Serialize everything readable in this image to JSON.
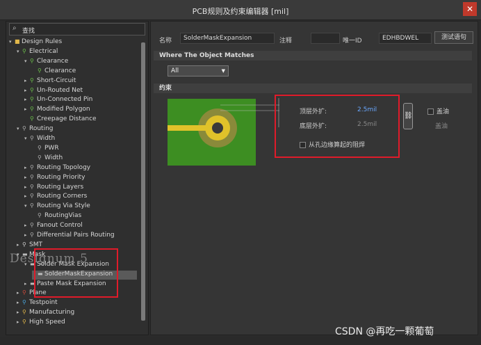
{
  "window": {
    "title": "PCB规则及约束编辑器 [mil]",
    "close_label": "✕"
  },
  "search": {
    "label": "查找"
  },
  "tree": [
    {
      "label": "Design Rules",
      "depth": 0,
      "arrow": "▾",
      "icon": "folder"
    },
    {
      "label": "Electrical",
      "depth": 1,
      "arrow": "▾",
      "icon": "rule"
    },
    {
      "label": "Clearance",
      "depth": 2,
      "arrow": "▾",
      "icon": "rule"
    },
    {
      "label": "Clearance",
      "depth": 3,
      "arrow": "",
      "icon": "rule"
    },
    {
      "label": "Short-Circuit",
      "depth": 2,
      "arrow": "▸",
      "icon": "rule"
    },
    {
      "label": "Un-Routed Net",
      "depth": 2,
      "arrow": "▸",
      "icon": "rule"
    },
    {
      "label": "Un-Connected Pin",
      "depth": 2,
      "arrow": "▸",
      "icon": "rule"
    },
    {
      "label": "Modified Polygon",
      "depth": 2,
      "arrow": "▸",
      "icon": "rule"
    },
    {
      "label": "Creepage Distance",
      "depth": 2,
      "arrow": "",
      "icon": "rule"
    },
    {
      "label": "Routing",
      "depth": 1,
      "arrow": "▾",
      "icon": "route"
    },
    {
      "label": "Width",
      "depth": 2,
      "arrow": "▾",
      "icon": "route"
    },
    {
      "label": "PWR",
      "depth": 3,
      "arrow": "",
      "icon": "route"
    },
    {
      "label": "Width",
      "depth": 3,
      "arrow": "",
      "icon": "route"
    },
    {
      "label": "Routing Topology",
      "depth": 2,
      "arrow": "▸",
      "icon": "route"
    },
    {
      "label": "Routing Priority",
      "depth": 2,
      "arrow": "▸",
      "icon": "route"
    },
    {
      "label": "Routing Layers",
      "depth": 2,
      "arrow": "▸",
      "icon": "route"
    },
    {
      "label": "Routing Corners",
      "depth": 2,
      "arrow": "▸",
      "icon": "route"
    },
    {
      "label": "Routing Via Style",
      "depth": 2,
      "arrow": "▾",
      "icon": "route"
    },
    {
      "label": "RoutingVias",
      "depth": 3,
      "arrow": "",
      "icon": "route"
    },
    {
      "label": "Fanout Control",
      "depth": 2,
      "arrow": "▸",
      "icon": "route"
    },
    {
      "label": "Differential Pairs Routing",
      "depth": 2,
      "arrow": "▸",
      "icon": "route"
    },
    {
      "label": "SMT",
      "depth": 1,
      "arrow": "▸",
      "icon": "smt"
    },
    {
      "label": "Mask",
      "depth": 1,
      "arrow": "▾",
      "icon": "mask"
    },
    {
      "label": "Solder Mask Expansion",
      "depth": 2,
      "arrow": "▾",
      "icon": "mask"
    },
    {
      "label": "SolderMaskExpansion",
      "depth": 3,
      "arrow": "",
      "icon": "mask",
      "selected": true
    },
    {
      "label": "Paste Mask Expansion",
      "depth": 2,
      "arrow": "▸",
      "icon": "mask"
    },
    {
      "label": "Plane",
      "depth": 1,
      "arrow": "▸",
      "icon": "plane"
    },
    {
      "label": "Testpoint",
      "depth": 1,
      "arrow": "▸",
      "icon": "test"
    },
    {
      "label": "Manufacturing",
      "depth": 1,
      "arrow": "▸",
      "icon": "mfg"
    },
    {
      "label": "High Speed",
      "depth": 1,
      "arrow": "▸",
      "icon": "hs"
    }
  ],
  "watermark": "Designum 5",
  "rule": {
    "name_label": "名称",
    "name_value": "SolderMaskExpansion",
    "comment_label": "注释",
    "comment_value": "",
    "uid_label": "唯一ID",
    "uid_value": "EDHBDWEL",
    "test_button": "测试语句"
  },
  "matches": {
    "header": "Where The Object Matches",
    "selected": "All"
  },
  "constraints": {
    "header": "约束",
    "top_label": "顶层外扩:",
    "top_value": "2.5mil",
    "bottom_label": "底层外扩:",
    "bottom_value": "2.5mil",
    "from_hole_label": "从孔边缘算起的阻焊",
    "tent_top_label": "盖油",
    "tent_bottom_label": "盖油"
  },
  "footer": {
    "credit": "CSDN @再吃一颗葡萄"
  }
}
